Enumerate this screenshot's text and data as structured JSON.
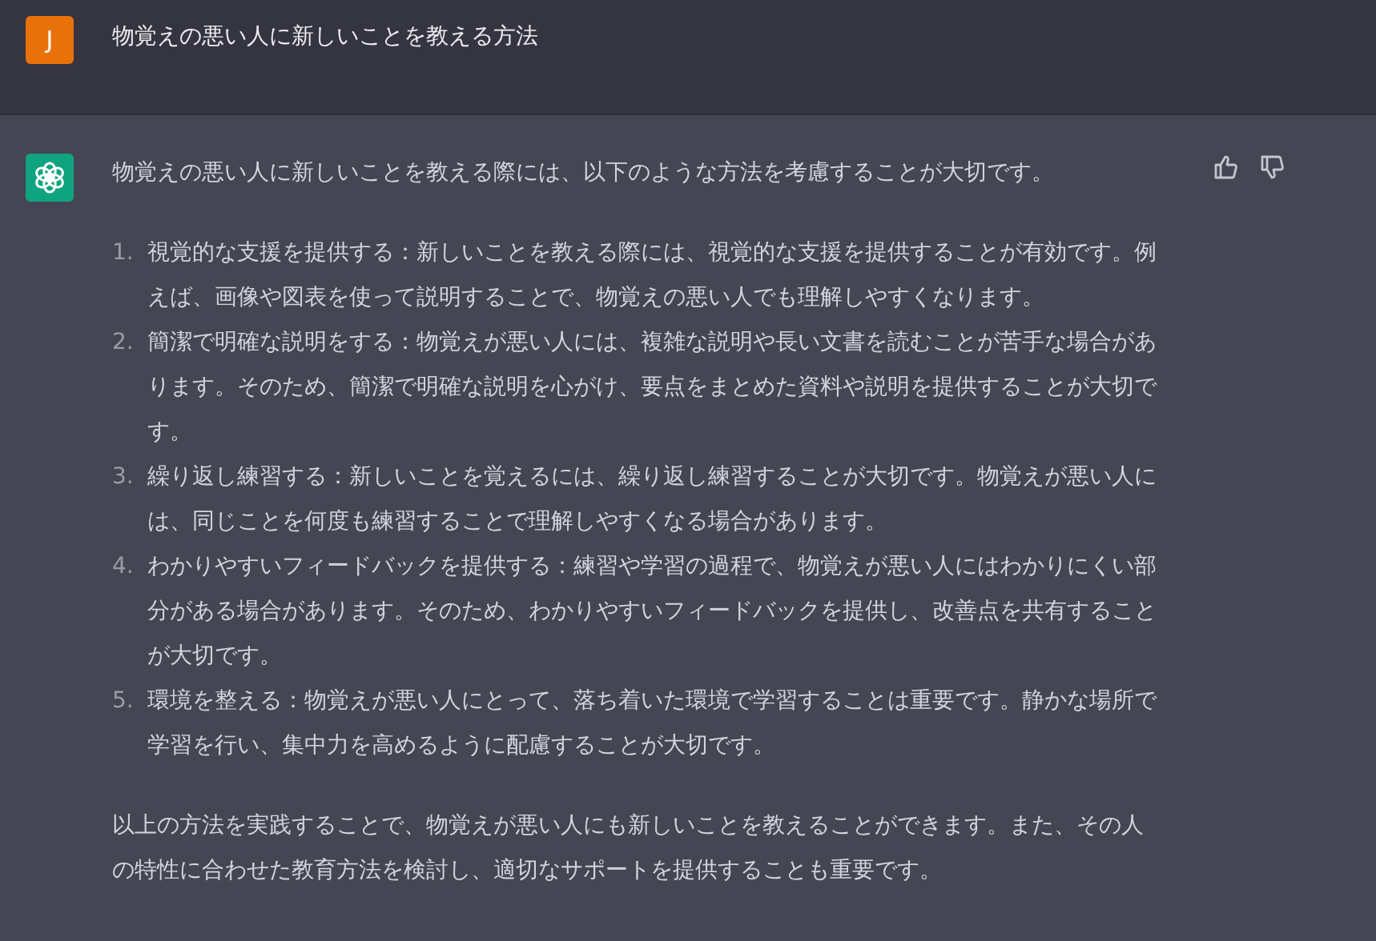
{
  "messages": [
    {
      "kind": "user",
      "avatar": "J",
      "text": "物覚えの悪い人に新しいことを教える方法"
    },
    {
      "kind": "assistant",
      "intro": "物覚えの悪い人に新しいことを教える際には、以下のような方法を考慮することが大切です。",
      "items": [
        {
          "number": "1.",
          "text": "視覚的な支援を提供する：新しいことを教える際には、視覚的な支援を提供することが有効です。例えば、画像や図表を使って説明することで、物覚えの悪い人でも理解しやすくなります。"
        },
        {
          "number": "2.",
          "text": "簡潔で明確な説明をする：物覚えが悪い人には、複雑な説明や長い文書を読むことが苦手な場合があります。そのため、簡潔で明確な説明を心がけ、要点をまとめた資料や説明を提供することが大切です。"
        },
        {
          "number": "3.",
          "text": "繰り返し練習する：新しいことを覚えるには、繰り返し練習することが大切です。物覚えが悪い人には、同じことを何度も練習することで理解しやすくなる場合があります。"
        },
        {
          "number": "4.",
          "text": "わかりやすいフィードバックを提供する：練習や学習の過程で、物覚えが悪い人にはわかりにくい部分がある場合があります。そのため、わかりやすいフィードバックを提供し、改善点を共有することが大切です。"
        },
        {
          "number": "5.",
          "text": "環境を整える：物覚えが悪い人にとって、落ち着いた環境で学習することは重要です。静かな場所で学習を行い、集中力を高めるように配慮することが大切です。"
        }
      ],
      "outro": "以上の方法を実践することで、物覚えが悪い人にも新しいことを教えることができます。また、その人の特性に合わせた教育方法を検討し、適切なサポートを提供することも重要です。"
    }
  ]
}
